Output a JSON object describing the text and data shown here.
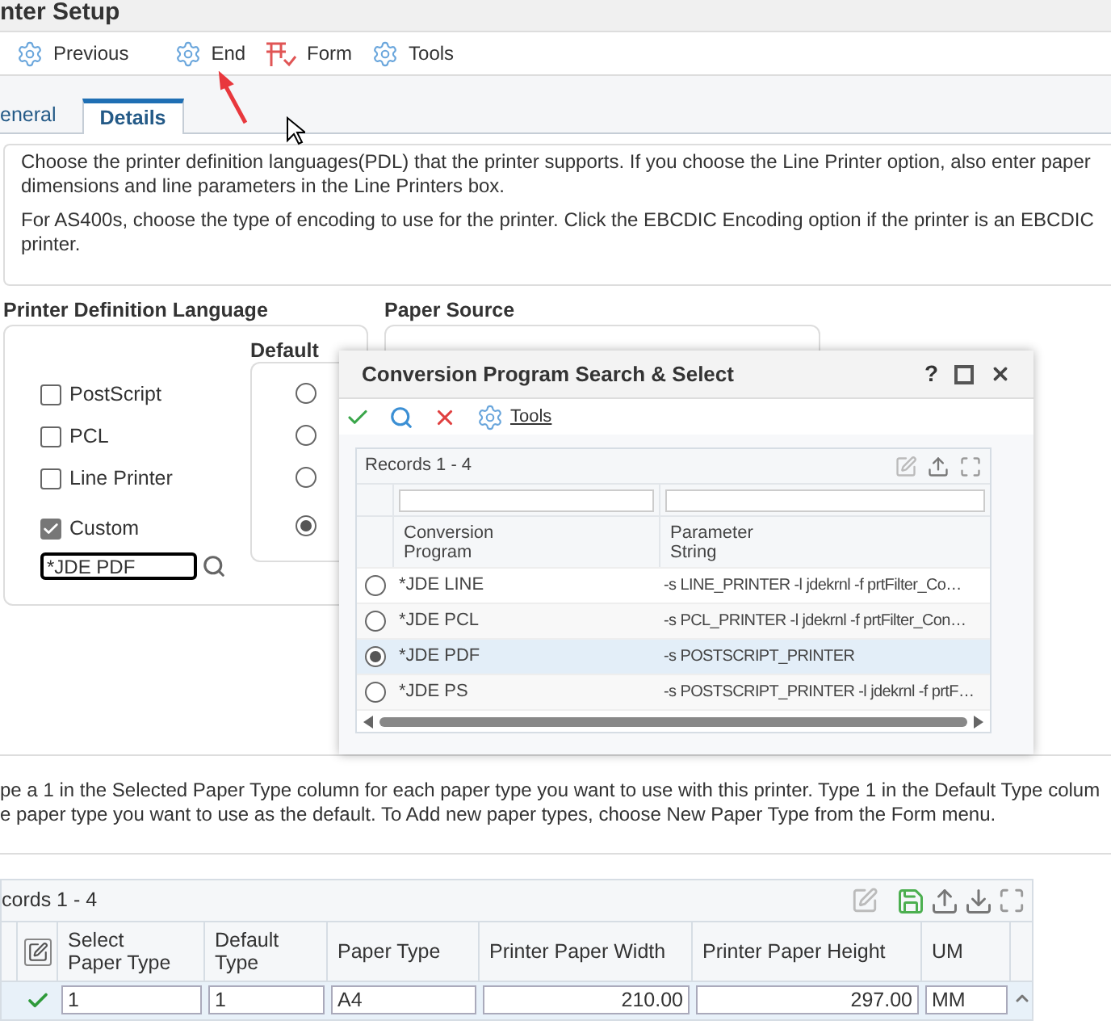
{
  "window": {
    "title": "nter Setup"
  },
  "toolbar": [
    {
      "label": "Previous",
      "kind": "gear"
    },
    {
      "label": "End",
      "kind": "gear"
    },
    {
      "label": "Form",
      "kind": "form"
    },
    {
      "label": "Tools",
      "kind": "gear"
    }
  ],
  "tabs": [
    {
      "label": "eneral",
      "selected": false
    },
    {
      "label": "Details",
      "selected": true
    }
  ],
  "description": [
    [
      "Choose the printer definition languages(PDL) that the printer supports. If you choose the Line Printer option, also enter paper",
      "dimensions and line parameters in the Line Printers box."
    ],
    [
      "For AS400s, choose the type of encoding to use for the printer. Click the EBCDIC Encoding option if the printer is an EBCDIC",
      "printer."
    ]
  ],
  "pdl": {
    "title": "Printer Definition Language",
    "options": [
      {
        "label": "PostScript",
        "checked": false
      },
      {
        "label": "PCL",
        "checked": false
      },
      {
        "label": "Line Printer",
        "checked": false
      },
      {
        "label": "Custom",
        "checked": true
      }
    ],
    "custom_value": "*JDE PDF",
    "default_title": "Default",
    "defaults": [
      {
        "selected": false
      },
      {
        "selected": false
      },
      {
        "selected": false
      },
      {
        "selected": true
      }
    ]
  },
  "paper_source": {
    "title": "Paper Source"
  },
  "popup": {
    "title": "Conversion Program Search & Select",
    "help": "?",
    "tools_label": "Tools",
    "records": "Records 1 - 4",
    "columns": [
      "Conversion Program",
      "Parameter String"
    ],
    "rows": [
      {
        "program": "*JDE LINE",
        "parameter": "-s LINE_PRINTER -l jdekrnl -f prtFilter_Co…",
        "selected": false
      },
      {
        "program": "*JDE PCL",
        "parameter": "-s PCL_PRINTER -l jdekrnl -f prtFilter_Con…",
        "selected": false
      },
      {
        "program": "*JDE PDF",
        "parameter": "-s POSTSCRIPT_PRINTER",
        "selected": true
      },
      {
        "program": "*JDE PS",
        "parameter": "-s POSTSCRIPT_PRINTER -l jdekrnl -f prtF…",
        "selected": false
      }
    ]
  },
  "paper_types": {
    "instructions": [
      "pe a 1 in the Selected Paper Type column for each paper type you want to use with this printer. Type 1 in the Default Type colum",
      "e paper type you want to use as the default. To Add new paper types, choose New Paper Type from the Form menu."
    ],
    "records": "cords 1 - 4",
    "columns": [
      "Select Paper Type",
      "Default Type",
      "Paper Type",
      "Printer Paper Width",
      "Printer Paper Height",
      "UM"
    ],
    "rows": [
      {
        "values": [
          "1",
          "1",
          "A4",
          "210.00",
          "297.00",
          "MM"
        ]
      }
    ]
  }
}
